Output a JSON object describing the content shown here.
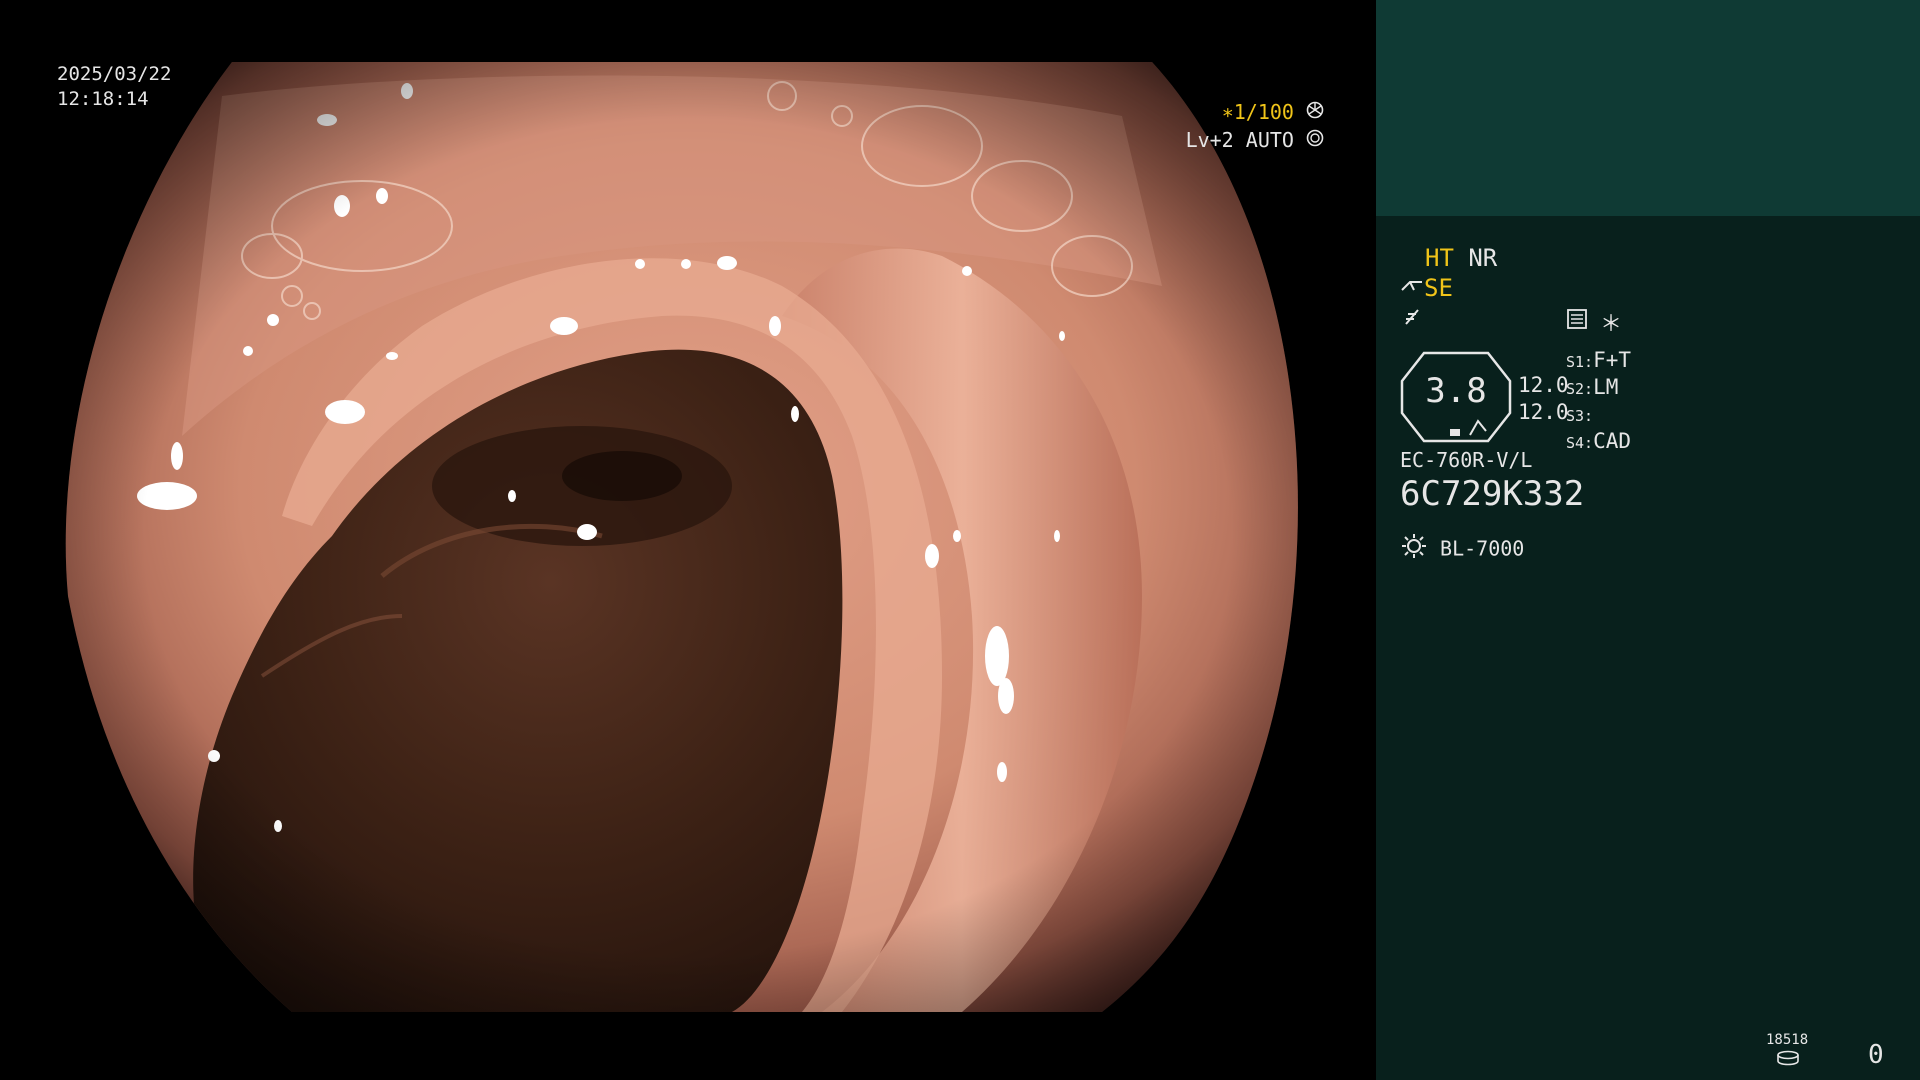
{
  "overlay": {
    "date": "2025/03/22",
    "time": "12:18:14",
    "shutter": "∗1/100",
    "shutter_icon": "aperture-icon",
    "level": "Lv+2",
    "mode": "AUTO",
    "mode_icon": "iris-icon"
  },
  "panel": {
    "ht": "HT",
    "nr": "NR",
    "se": "SE",
    "se_icon": "scope-tip-icon",
    "freeze_icon": "freeze-icon",
    "memo_icon": "list-icon",
    "asterisk": "＊",
    "zoom_value": "3.8",
    "val1": "12.0",
    "val2": "12.0",
    "s1_key": "S1:",
    "s1_val": "F+T",
    "s2_key": "S2:",
    "s2_val": "LM",
    "s3_key": "S3:",
    "s3_val": "",
    "s4_key": "S4:",
    "s4_val": "CAD",
    "scope_model": "EC-760R-V/L",
    "serial": "6C729K332",
    "light_icon": "sun-icon",
    "light_source": "BL-7000",
    "counter_small": "18518",
    "counter_big": "0",
    "disk_icon": "disk-icon"
  },
  "colors": {
    "panel_bg": "#08201c",
    "panel_top": "#0f3a34",
    "accent_yellow": "#f0c419"
  }
}
